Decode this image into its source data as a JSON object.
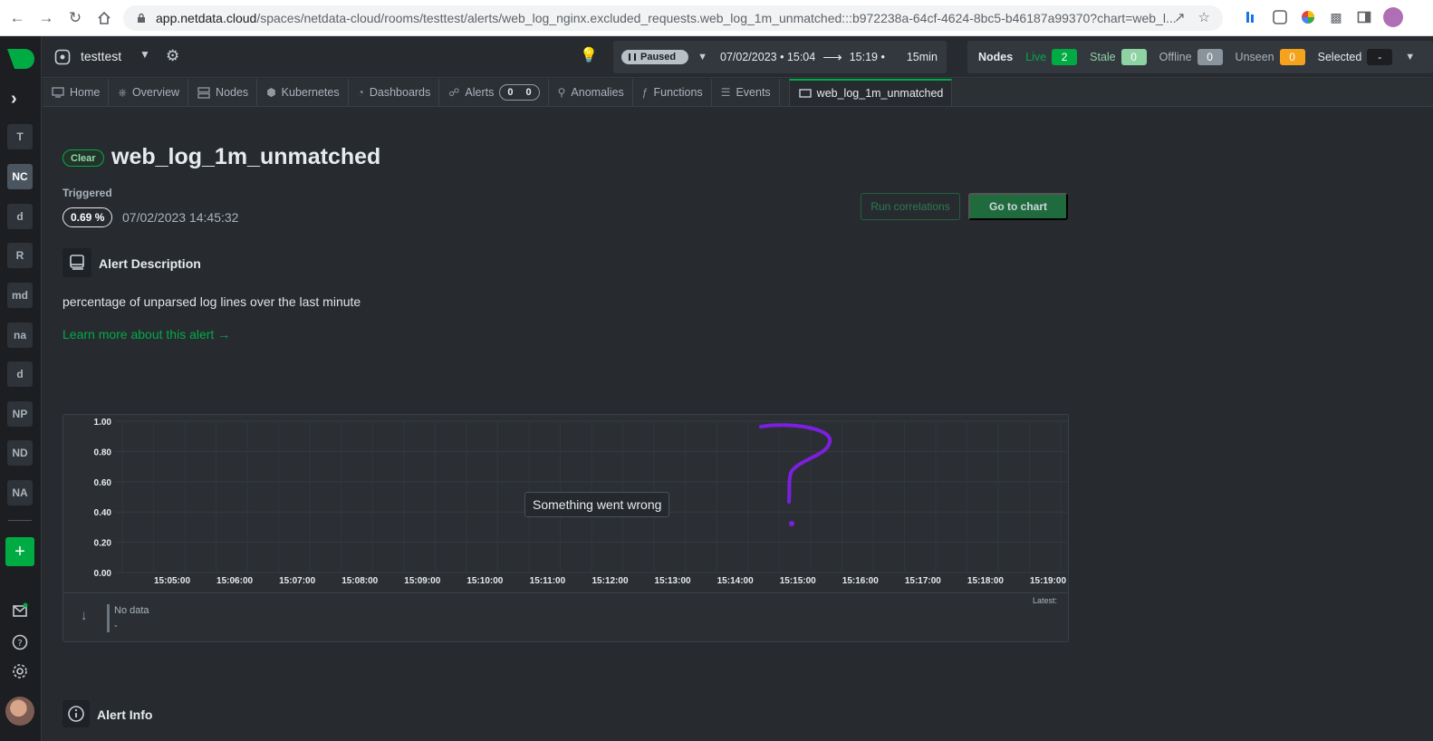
{
  "browser": {
    "url_host": "app.netdata.cloud",
    "url_path": "/spaces/netdata-cloud/rooms/testtest/alerts/web_log_nginx.excluded_requests.web_log_1m_unmatched:::b972238a-64cf-4624-8bc5-b46187a99370?chart=web_l..."
  },
  "spaces": {
    "items": [
      "T",
      "NC",
      "d",
      "R",
      "md",
      "na",
      "d",
      "NP",
      "ND",
      "NA"
    ],
    "active_index": 1,
    "add_label": "+"
  },
  "header": {
    "room_name": "testtest",
    "status": "Paused",
    "time_start": "07/02/2023 • 15:04",
    "time_end": "15:19 •",
    "duration": "15min",
    "nodes_title": "Nodes",
    "nodes": [
      {
        "label": "Live",
        "count": "2",
        "color": "#00ab44",
        "label_color": "#00ab44"
      },
      {
        "label": "Stale",
        "count": "0",
        "color": "#8fd3a5",
        "label_color": "#8fd3a5"
      },
      {
        "label": "Offline",
        "count": "0",
        "color": "#8a949d",
        "label_color": "#aab3bb"
      },
      {
        "label": "Unseen",
        "count": "0",
        "color": "#f5a21c",
        "label_color": "#aab3bb"
      },
      {
        "label": "Selected",
        "count": "-",
        "color": "#1c1e22",
        "label_color": "#e6ebef"
      }
    ]
  },
  "tabs": {
    "home": "Home",
    "overview": "Overview",
    "nodes": "Nodes",
    "kubernetes": "Kubernetes",
    "dashboards": "Dashboards",
    "alerts": "Alerts",
    "alerts_critical": "0",
    "alerts_warning": "0",
    "anomalies": "Anomalies",
    "functions": "Functions",
    "events": "Events",
    "active": "web_log_1m_unmatched"
  },
  "alert": {
    "status": "Clear",
    "name": "web_log_1m_unmatched",
    "triggered_label": "Triggered",
    "triggered_value": "0.69 %",
    "triggered_time": "07/02/2023 14:45:32",
    "run_correlations": "Run correlations",
    "go_to_chart": "Go to chart",
    "description_title": "Alert Description",
    "description": "percentage of unparsed log lines over the last minute",
    "learn_more": "Learn more about this alert →",
    "info_title": "Alert Info"
  },
  "chart_data": {
    "type": "line",
    "title": "",
    "xlabel": "",
    "ylabel": "",
    "yticks": [
      "1.00",
      "0.80",
      "0.60",
      "0.40",
      "0.20",
      "0.00"
    ],
    "xticks": [
      "15:05:00",
      "15:06:00",
      "15:07:00",
      "15:08:00",
      "15:09:00",
      "15:10:00",
      "15:11:00",
      "15:12:00",
      "15:13:00",
      "15:14:00",
      "15:15:00",
      "15:16:00",
      "15:17:00",
      "15:18:00",
      "15:19:00"
    ],
    "ylim": [
      0,
      1
    ],
    "grid": true,
    "series": [],
    "error_message": "Something went wrong",
    "legend": {
      "name": "No data",
      "value": "-",
      "latest_label": "Latest:"
    }
  }
}
